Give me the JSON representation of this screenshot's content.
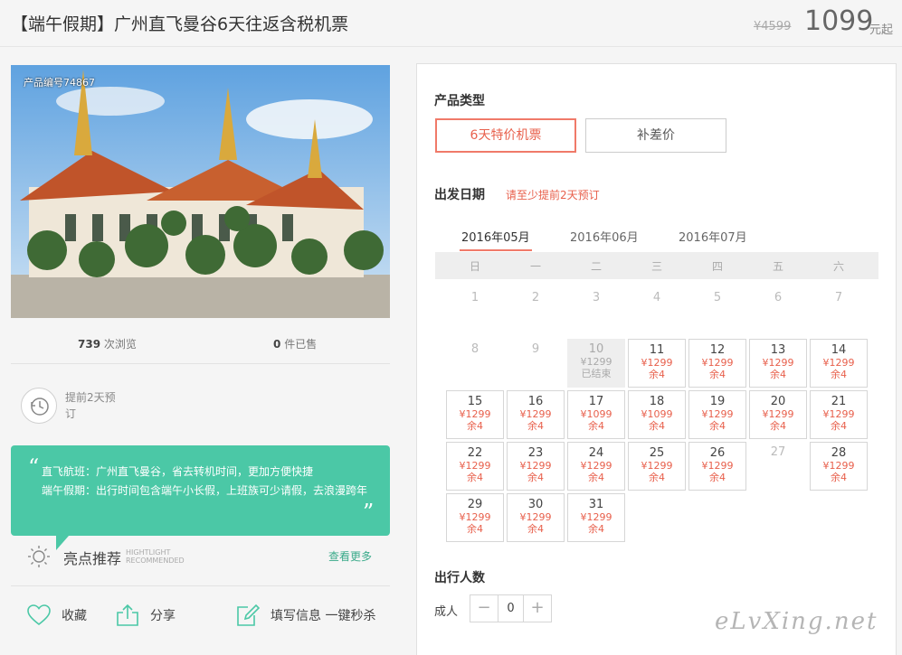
{
  "header": {
    "title": "【端午假期】广州直飞曼谷6天往返含税机票",
    "old_price": "¥4599",
    "price": "1099",
    "price_unit": "元起"
  },
  "photo": {
    "product_no": "产品编号74867"
  },
  "stats": {
    "views": "739",
    "views_label": "次浏览",
    "sold": "0",
    "sold_label": "件已售"
  },
  "advance": {
    "text": "提前2天预订"
  },
  "highlights": {
    "line1": "直飞航班：广州直飞曼谷，省去转机时间，更加方便快捷",
    "line2": "端午假期：出行时间包含端午小长假，上班族可少请假，去浪漫跨年",
    "title": "亮点推荐",
    "sub1": "HIGHTLIGHT",
    "sub2": "RECOMMENDED",
    "more": "查看更多"
  },
  "actions": {
    "favorite": "收藏",
    "share": "分享",
    "fill_info": "填写信息 一键秒杀"
  },
  "product_type": {
    "label": "产品类型",
    "options": [
      "6天特价机票",
      "补差价"
    ],
    "selected": "6天特价机票"
  },
  "departure": {
    "label": "出发日期",
    "tip": "请至少提前2天预订",
    "months": [
      "2016年05月",
      "2016年06月",
      "2016年07月"
    ],
    "active_month": "2016年05月",
    "weekdays": [
      "日",
      "一",
      "二",
      "三",
      "四",
      "五",
      "六"
    ],
    "days": [
      {
        "d": "1",
        "state": "plain"
      },
      {
        "d": "2",
        "state": "plain"
      },
      {
        "d": "3",
        "state": "plain"
      },
      {
        "d": "4",
        "state": "plain"
      },
      {
        "d": "5",
        "state": "plain"
      },
      {
        "d": "6",
        "state": "plain"
      },
      {
        "d": "7",
        "state": "plain"
      },
      {
        "d": "8",
        "state": "plain"
      },
      {
        "d": "9",
        "state": "plain"
      },
      {
        "d": "10",
        "state": "ended",
        "price": "¥1299",
        "note": "已结束"
      },
      {
        "d": "11",
        "state": "avail",
        "price": "¥1299",
        "note": "余4"
      },
      {
        "d": "12",
        "state": "avail",
        "price": "¥1299",
        "note": "余4"
      },
      {
        "d": "13",
        "state": "avail",
        "price": "¥1299",
        "note": "余4"
      },
      {
        "d": "14",
        "state": "avail",
        "price": "¥1299",
        "note": "余4"
      },
      {
        "d": "15",
        "state": "avail",
        "price": "¥1299",
        "note": "余4"
      },
      {
        "d": "16",
        "state": "avail",
        "price": "¥1299",
        "note": "余4"
      },
      {
        "d": "17",
        "state": "avail",
        "price": "¥1099",
        "note": "余4"
      },
      {
        "d": "18",
        "state": "avail",
        "price": "¥1099",
        "note": "余4"
      },
      {
        "d": "19",
        "state": "avail",
        "price": "¥1299",
        "note": "余4"
      },
      {
        "d": "20",
        "state": "avail",
        "price": "¥1299",
        "note": "余4"
      },
      {
        "d": "21",
        "state": "avail",
        "price": "¥1299",
        "note": "余4"
      },
      {
        "d": "22",
        "state": "avail",
        "price": "¥1299",
        "note": "余4"
      },
      {
        "d": "23",
        "state": "avail",
        "price": "¥1299",
        "note": "余4"
      },
      {
        "d": "24",
        "state": "avail",
        "price": "¥1299",
        "note": "余4"
      },
      {
        "d": "25",
        "state": "avail",
        "price": "¥1299",
        "note": "余4"
      },
      {
        "d": "26",
        "state": "avail",
        "price": "¥1299",
        "note": "余4"
      },
      {
        "d": "27",
        "state": "plain"
      },
      {
        "d": "28",
        "state": "avail",
        "price": "¥1299",
        "note": "余4"
      },
      {
        "d": "29",
        "state": "avail",
        "price": "¥1299",
        "note": "余4"
      },
      {
        "d": "30",
        "state": "avail",
        "price": "¥1299",
        "note": "余4"
      },
      {
        "d": "31",
        "state": "avail",
        "price": "¥1299",
        "note": "余4"
      }
    ]
  },
  "travelers": {
    "label": "出行人数",
    "adult_label": "成人",
    "count": "0",
    "minus": "−",
    "plus": "+"
  },
  "watermark": "eLvXing.net",
  "colors": {
    "accent": "#e8604c",
    "teal": "#4bc8a6"
  }
}
